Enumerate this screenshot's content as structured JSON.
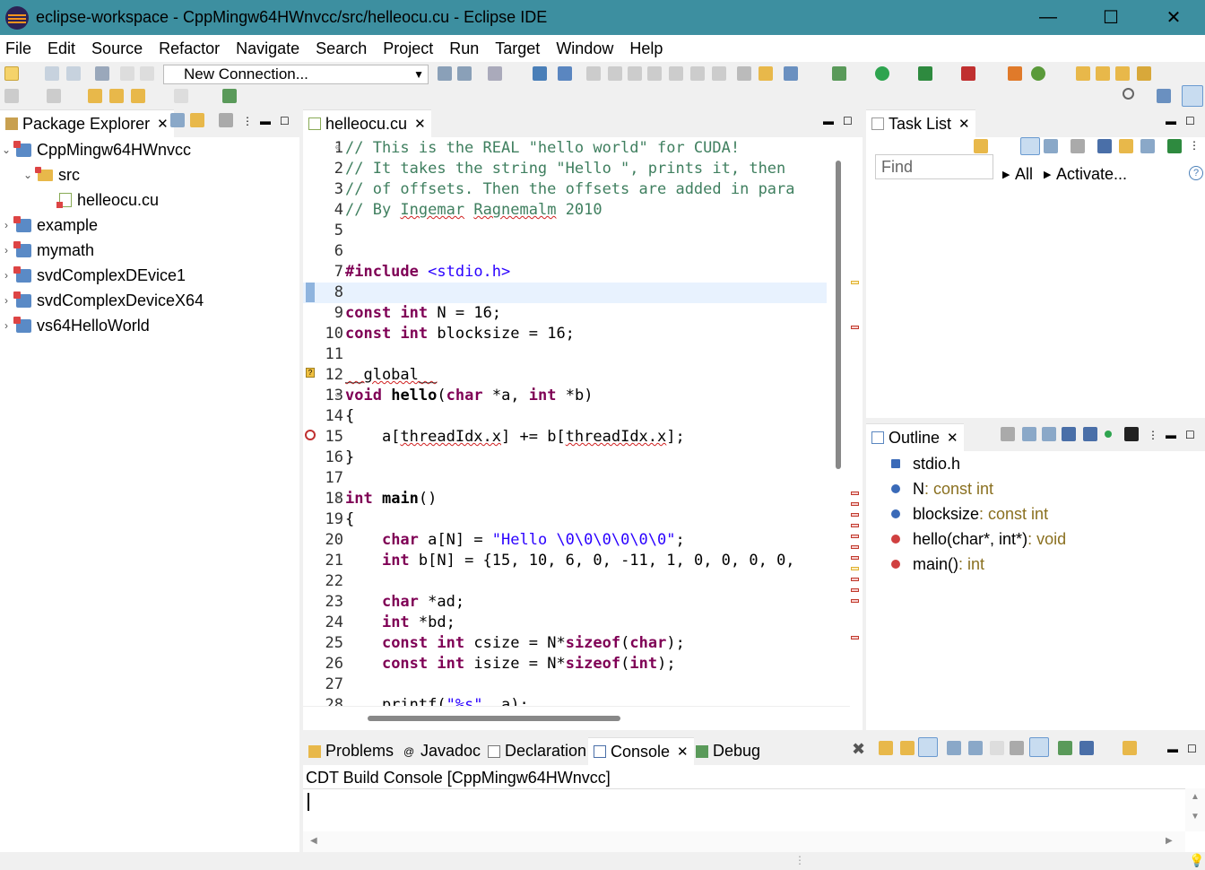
{
  "window": {
    "title": "eclipse-workspace - CppMingw64HWnvcc/src/helleocu.cu - Eclipse IDE",
    "minimize": "—",
    "maximize": "☐",
    "close": "✕"
  },
  "menu": [
    "File",
    "Edit",
    "Source",
    "Refactor",
    "Navigate",
    "Search",
    "Project",
    "Run",
    "Target",
    "Window",
    "Help"
  ],
  "toolbar": {
    "connection_combo": "New Connection..."
  },
  "package_explorer": {
    "tab_label": "Package Explorer",
    "items": [
      {
        "label": "CppMingw64HWnvcc",
        "level": 0,
        "expanded": true,
        "kind": "project"
      },
      {
        "label": "src",
        "level": 1,
        "expanded": true,
        "kind": "folder"
      },
      {
        "label": "helleocu.cu",
        "level": 2,
        "kind": "file"
      },
      {
        "label": "example",
        "level": 0,
        "expanded": false,
        "kind": "project"
      },
      {
        "label": "mymath",
        "level": 0,
        "expanded": false,
        "kind": "project"
      },
      {
        "label": "svdComplexDEvice1",
        "level": 0,
        "expanded": false,
        "kind": "project"
      },
      {
        "label": "svdComplexDeviceX64",
        "level": 0,
        "expanded": false,
        "kind": "project"
      },
      {
        "label": "vs64HelloWorld",
        "level": 0,
        "expanded": false,
        "kind": "project"
      }
    ]
  },
  "editor": {
    "tab_label": "helleocu.cu",
    "lines": [
      {
        "n": "1",
        "fold": "⊖",
        "text": "// This is the REAL \"hello world\" for CUDA!"
      },
      {
        "n": "2",
        "text": "// It takes the string \"Hello \", prints it, then"
      },
      {
        "n": "3",
        "text": "// of offsets. Then the offsets are added in para"
      },
      {
        "n": "4",
        "text": "// By Ingemar Ragnemalm 2010"
      },
      {
        "n": "5",
        "text": ""
      },
      {
        "n": "6",
        "text": ""
      },
      {
        "n": "7",
        "text": "#include <stdio.h>"
      },
      {
        "n": "8",
        "text": ""
      },
      {
        "n": "9",
        "text": "const int N = 16;"
      },
      {
        "n": "10",
        "text": "const int blocksize = 16;"
      },
      {
        "n": "11",
        "text": ""
      },
      {
        "n": "12",
        "text": "__global__"
      },
      {
        "n": "13",
        "fold": "⊖",
        "text": "void hello(char *a, int *b)"
      },
      {
        "n": "14",
        "text": "{"
      },
      {
        "n": "15",
        "text": "    a[threadIdx.x] += b[threadIdx.x];"
      },
      {
        "n": "16",
        "text": "}"
      },
      {
        "n": "17",
        "text": ""
      },
      {
        "n": "18",
        "fold": "⊖",
        "text": "int main()"
      },
      {
        "n": "19",
        "text": "{"
      },
      {
        "n": "20",
        "text": "    char a[N] = \"Hello \\0\\0\\0\\0\\0\\0\";"
      },
      {
        "n": "21",
        "text": "    int b[N] = {15, 10, 6, 0, -11, 1, 0, 0, 0, 0,"
      },
      {
        "n": "22",
        "text": ""
      },
      {
        "n": "23",
        "text": "    char *ad;"
      },
      {
        "n": "24",
        "text": "    int *bd;"
      },
      {
        "n": "25",
        "text": "    const int csize = N*sizeof(char);"
      },
      {
        "n": "26",
        "text": "    const int isize = N*sizeof(int);"
      },
      {
        "n": "27",
        "text": ""
      },
      {
        "n": "28",
        "text": "    printf(\"%s\", a);"
      }
    ]
  },
  "task_list": {
    "tab_label": "Task List",
    "find_placeholder": "Find",
    "all_label": "All",
    "activate_label": "Activate..."
  },
  "outline": {
    "tab_label": "Outline",
    "items": [
      {
        "name": "stdio.h",
        "type": ""
      },
      {
        "name": "N",
        "type": " : const int"
      },
      {
        "name": "blocksize",
        "type": " : const int"
      },
      {
        "name": "hello(char*, int*)",
        "type": " : void"
      },
      {
        "name": "main()",
        "type": " : int"
      }
    ]
  },
  "bottom_panel": {
    "tabs": [
      "Problems",
      "Javadoc",
      "Declaration",
      "Console",
      "Debug"
    ],
    "active_tab": "Console",
    "console_title": "CDT Build Console [CppMingw64HWnvcc]"
  },
  "colors": {
    "titlebar": "#3d8fa0",
    "comment": "#3f7f5f",
    "keyword": "#7f0055",
    "string": "#2a00ff"
  }
}
